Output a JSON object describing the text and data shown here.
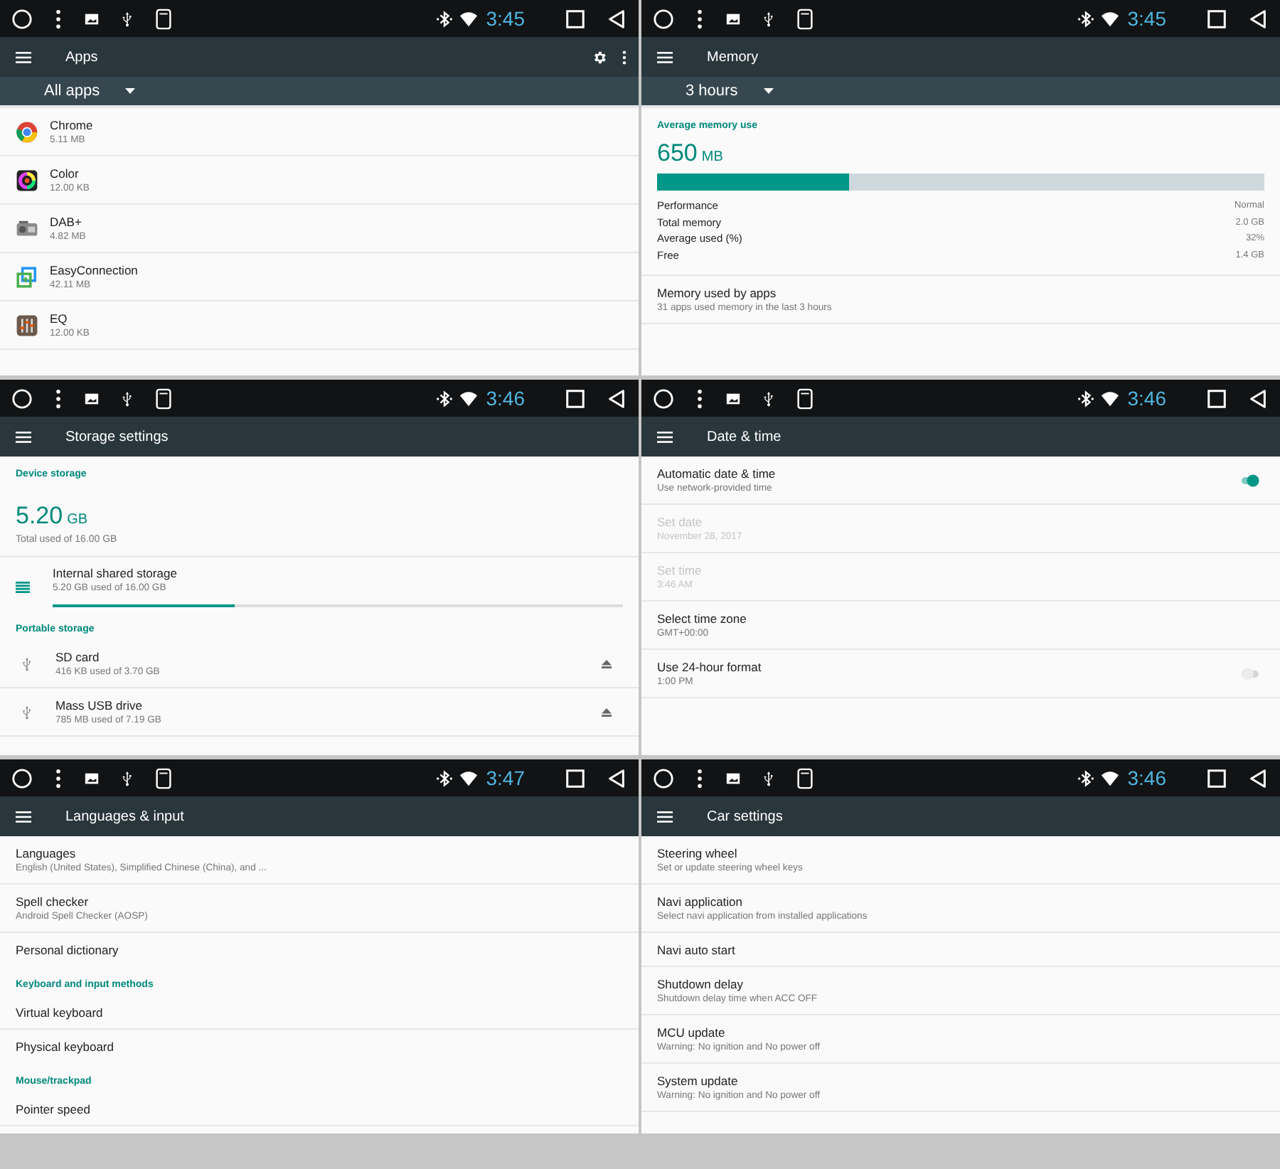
{
  "panels": [
    {
      "status": {
        "time": "3:45"
      },
      "toolbar": {
        "title": "Apps",
        "has_actions": true
      },
      "spinner": {
        "label": "All apps"
      },
      "content": [
        {
          "kind": "app",
          "title": "Chrome",
          "subtitle": "5.11 MB"
        },
        {
          "kind": "app",
          "title": "Color",
          "subtitle": "12.00 KB"
        },
        {
          "kind": "app",
          "title": "DAB+",
          "subtitle": "4.82 MB"
        },
        {
          "kind": "app",
          "title": "EasyConnection",
          "subtitle": "42.11 MB"
        },
        {
          "kind": "app",
          "title": "EQ",
          "subtitle": "12.00 KB"
        }
      ]
    },
    {
      "status": {
        "time": "3:45"
      },
      "toolbar": {
        "title": "Memory",
        "has_actions": false
      },
      "spinner": {
        "label": "3 hours"
      },
      "content": [
        {
          "kind": "heading",
          "text": "Average memory use"
        },
        {
          "kind": "figure",
          "value": "650",
          "unit": "MB"
        },
        {
          "kind": "meter",
          "level": 0.317
        },
        {
          "kind": "stat",
          "label": "Performance",
          "value": "Normal"
        },
        {
          "kind": "stat",
          "label": "Total memory",
          "value": "2.0 GB"
        },
        {
          "kind": "stat",
          "label": "Average used (%)",
          "value": "32%"
        },
        {
          "kind": "stat",
          "label": "Free",
          "value": "1.4 GB"
        },
        {
          "kind": "item",
          "title": "Memory used by apps",
          "subtitle": "31 apps used memory in the last 3 hours"
        }
      ]
    },
    {
      "status": {
        "time": "3:46"
      },
      "toolbar": {
        "title": "Storage settings",
        "has_actions": false
      },
      "content": [
        {
          "kind": "heading",
          "text": "Device storage"
        },
        {
          "kind": "figure",
          "value": "5.20",
          "unit": "GB",
          "caption": "Total used of 16.00 GB"
        },
        {
          "kind": "storage",
          "title": "Internal shared storage",
          "subtitle": "5.20 GB used of 16.00 GB",
          "level": 0.32
        },
        {
          "kind": "heading",
          "text": "Portable storage"
        },
        {
          "kind": "volume",
          "title": "SD card",
          "subtitle": "416 KB used of 3.70 GB"
        },
        {
          "kind": "volume",
          "title": "Mass USB drive",
          "subtitle": "785 MB used of 7.19 GB"
        }
      ]
    },
    {
      "status": {
        "time": "3:46"
      },
      "toolbar": {
        "title": "Date & time",
        "has_actions": false
      },
      "content": [
        {
          "kind": "switch",
          "title": "Automatic date & time",
          "subtitle": "Use network-provided time",
          "disabled": false,
          "on": true
        },
        {
          "kind": "item",
          "title": "Set date",
          "subtitle": "November 28, 2017",
          "disabled": true
        },
        {
          "kind": "item",
          "title": "Set time",
          "subtitle": "3:46 AM",
          "disabled": true
        },
        {
          "kind": "item",
          "title": "Select time zone",
          "subtitle": "GMT+00:00",
          "disabled": false
        },
        {
          "kind": "switch",
          "title": "Use 24-hour format",
          "subtitle": "1:00 PM",
          "disabled": false,
          "on": false
        }
      ]
    },
    {
      "status": {
        "time": "3:47"
      },
      "toolbar": {
        "title": "Languages & input",
        "has_actions": false
      },
      "content": [
        {
          "kind": "item",
          "title": "Languages",
          "subtitle": "English (United States), Simplified Chinese (China), and ..."
        },
        {
          "kind": "item",
          "title": "Spell checker",
          "subtitle": "Android Spell Checker (AOSP)"
        },
        {
          "kind": "item",
          "title": "Personal dictionary"
        },
        {
          "kind": "heading",
          "text": "Keyboard and input methods"
        },
        {
          "kind": "item",
          "title": "Virtual keyboard"
        },
        {
          "kind": "item",
          "title": "Physical keyboard"
        },
        {
          "kind": "heading",
          "text": "Mouse/trackpad"
        },
        {
          "kind": "item",
          "title": "Pointer speed"
        }
      ]
    },
    {
      "status": {
        "time": "3:46"
      },
      "toolbar": {
        "title": "Car settings",
        "has_actions": false
      },
      "content": [
        {
          "kind": "item",
          "title": "Steering wheel",
          "subtitle": "Set or update steering wheel keys"
        },
        {
          "kind": "item",
          "title": "Navi application",
          "subtitle": "Select navi application from installed applications"
        },
        {
          "kind": "item",
          "title": "Navi auto start"
        },
        {
          "kind": "item",
          "title": "Shutdown delay",
          "subtitle": "Shutdown delay time when ACC OFF"
        },
        {
          "kind": "item",
          "title": "MCU update",
          "subtitle": "Warning: No ignition and No power off"
        },
        {
          "kind": "item",
          "title": "System update",
          "subtitle": "Warning: No ignition and No power off"
        }
      ]
    }
  ]
}
